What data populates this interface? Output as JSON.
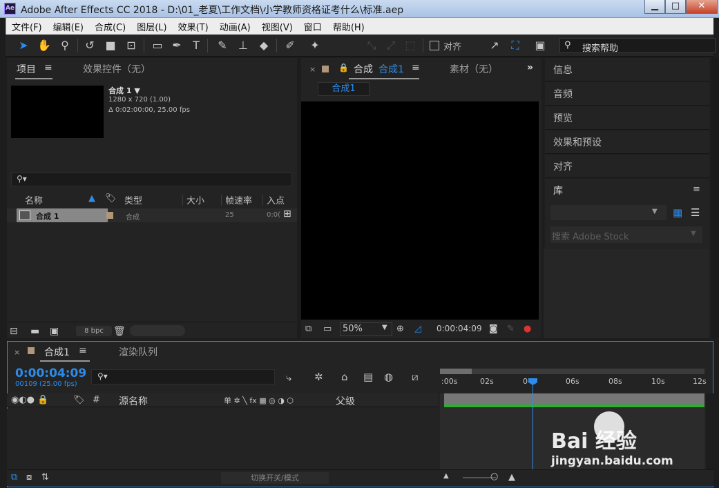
{
  "window": {
    "title": "Adobe After Effects CC 2018 - D:\\01_老夏\\工作文档\\小学教师资格证考什么\\标准.aep",
    "logo": "Ae",
    "minimize": "▁",
    "maximize": "□",
    "close": "✕"
  },
  "menu": [
    "文件(F)",
    "编辑(E)",
    "合成(C)",
    "图层(L)",
    "效果(T)",
    "动画(A)",
    "视图(V)",
    "窗口",
    "帮助(H)"
  ],
  "toolbar": {
    "align_label": "对齐",
    "help_search_placeholder": "搜索帮助",
    "icons": [
      "selection-icon",
      "hand-icon",
      "zoom-icon",
      "rotate-icon",
      "camera-icon",
      "pan-behind-icon",
      "rectangle-icon",
      "pen-icon",
      "text-icon",
      "brush-icon",
      "clone-stamp-icon",
      "eraser-icon",
      "roto-brush-icon",
      "puppet-pin-icon"
    ]
  },
  "project_panel": {
    "tab_project": "项目",
    "tab_effects": "效果控件（无）",
    "selected_name": "合成 1 ▼",
    "selected_res": "1280 x 720 (1.00)",
    "selected_duration": "Δ 0:02:00:00, 25.00 fps",
    "columns": [
      "名称",
      "类型",
      "大小",
      "帧速率",
      "入点"
    ],
    "row": {
      "name": "合成 1",
      "type": "合成",
      "fps": "25",
      "in": "0:0("
    },
    "bpc": "8 bpc"
  },
  "viewer": {
    "tab_comp_prefix": "合成",
    "tab_comp_name": "合成1",
    "tab_footage": "素材（无）",
    "sub_tab": "合成1",
    "zoom": "50%",
    "timecode": "0:00:04:09"
  },
  "right_panels": {
    "items": [
      "信息",
      "音频",
      "预览",
      "效果和预设",
      "对齐",
      "库"
    ],
    "stock_placeholder": "搜索 Adobe Stock"
  },
  "timeline": {
    "tab_comp": "合成1",
    "tab_render": "渲染队列",
    "timecode": "0:00:04:09",
    "frames": "00109 (25.00 fps)",
    "col_source": "源名称",
    "col_parent": "父级",
    "col_switch_icons": "单 ✲ ╲ fx ▦ ◎ ◑ ⬡",
    "ruler": [
      ":00s",
      "02s",
      "04s",
      "06s",
      "08s",
      "10s",
      "12s"
    ],
    "toggle_modes": "切换开关/模式",
    "playhead_fraction": 0.34
  },
  "watermark": {
    "brand": "Bai  经验",
    "url": "jingyan.baidu.com"
  }
}
